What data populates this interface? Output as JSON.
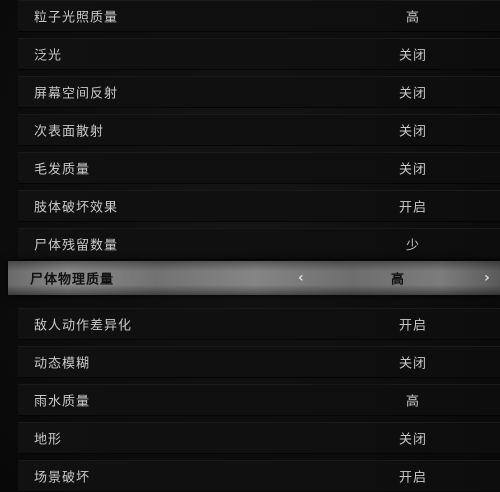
{
  "settings": [
    {
      "label": "粒子光照质量",
      "value": "高"
    },
    {
      "label": "泛光",
      "value": "关闭"
    },
    {
      "label": "屏幕空间反射",
      "value": "关闭"
    },
    {
      "label": "次表面散射",
      "value": "关闭"
    },
    {
      "label": "毛发质量",
      "value": "关闭"
    },
    {
      "label": "肢体破坏效果",
      "value": "开启"
    },
    {
      "label": "尸体残留数量",
      "value": "少"
    },
    {
      "label": "尸体物理质量",
      "value": "高"
    },
    {
      "label": "敌人动作差异化",
      "value": "开启"
    },
    {
      "label": "动态模糊",
      "value": "关闭"
    },
    {
      "label": "雨水质量",
      "value": "高"
    },
    {
      "label": "地形",
      "value": "关闭"
    },
    {
      "label": "场景破坏",
      "value": "开启"
    }
  ],
  "selected_index": 7,
  "arrows": {
    "left": "‹",
    "right": "›"
  },
  "colors": {
    "text": "#c9c9c9",
    "selected_text": "#111111",
    "background": "#0d0d0d",
    "selected_background": "#7a7a7a"
  }
}
